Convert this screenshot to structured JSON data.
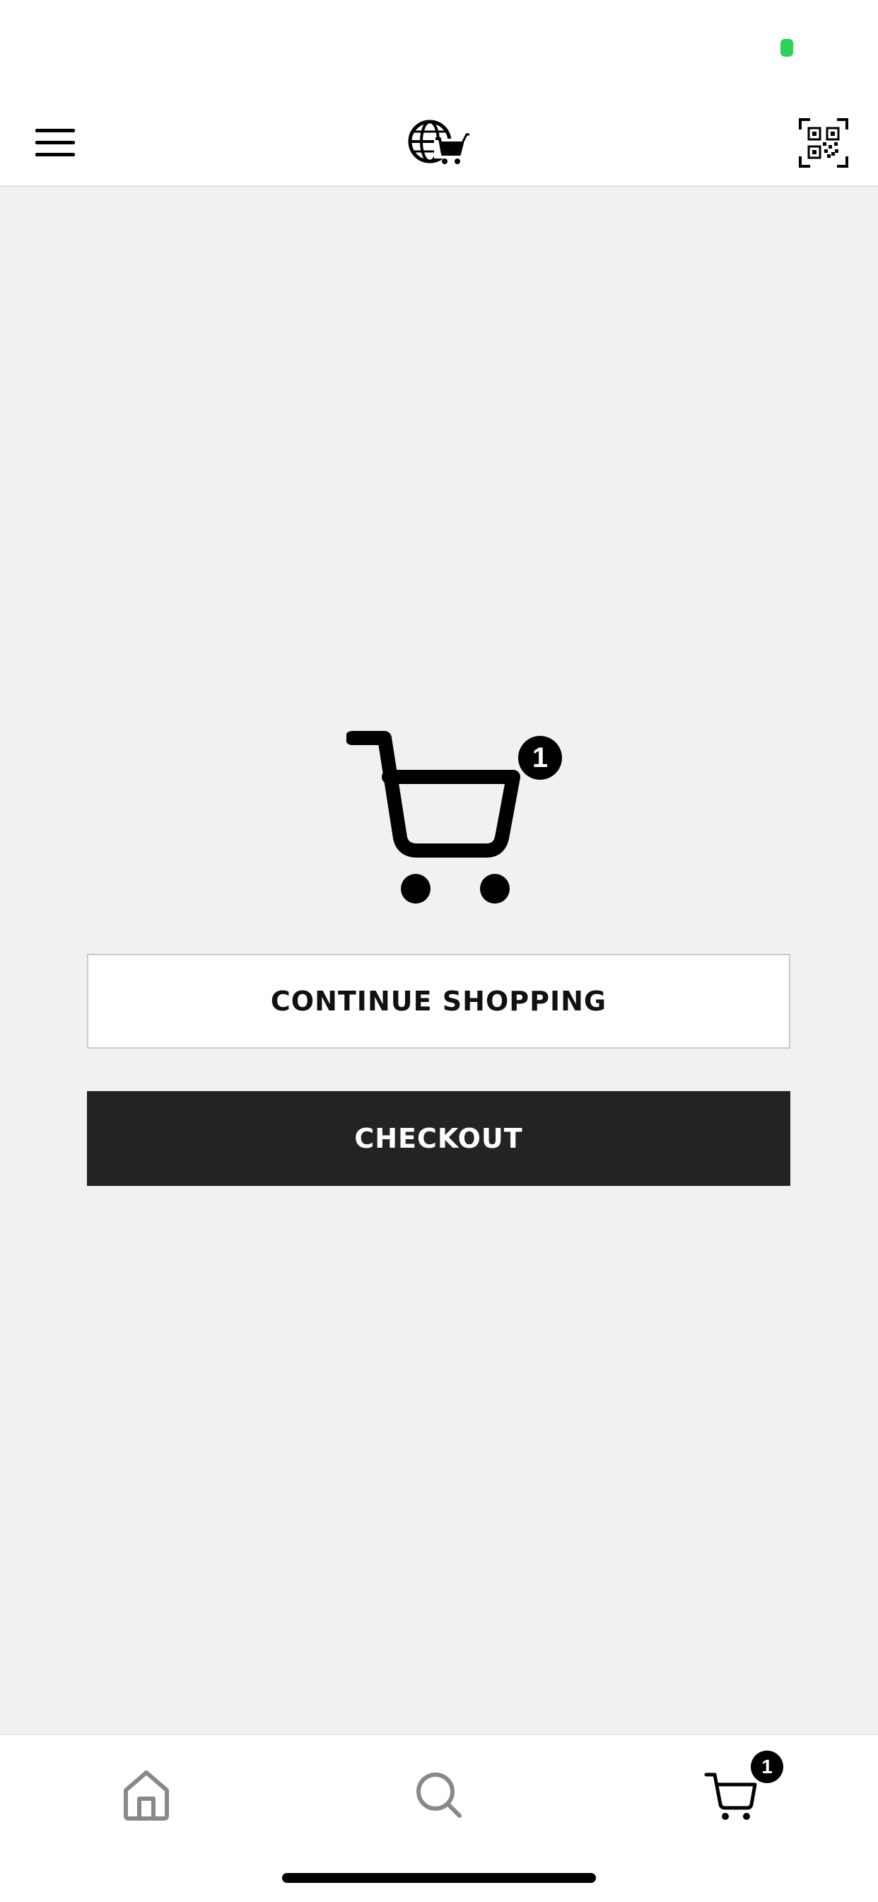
{
  "colors": {
    "status_indicator": "#2fd158",
    "page_background": "#f1f1f1",
    "checkout_background": "#232323",
    "badge_background": "#000000"
  },
  "header": {
    "menu_icon": "hamburger-menu-icon",
    "logo_icon": "globe-cart-logo-icon",
    "qr_icon": "qr-code-scan-icon"
  },
  "cart": {
    "icon": "shopping-cart-icon",
    "item_count": "1"
  },
  "buttons": {
    "continue_label": "CONTINUE SHOPPING",
    "checkout_label": "CHECKOUT"
  },
  "tabbar": {
    "home_icon": "home-icon",
    "search_icon": "search-icon",
    "cart_icon": "cart-icon",
    "cart_badge": "1"
  }
}
